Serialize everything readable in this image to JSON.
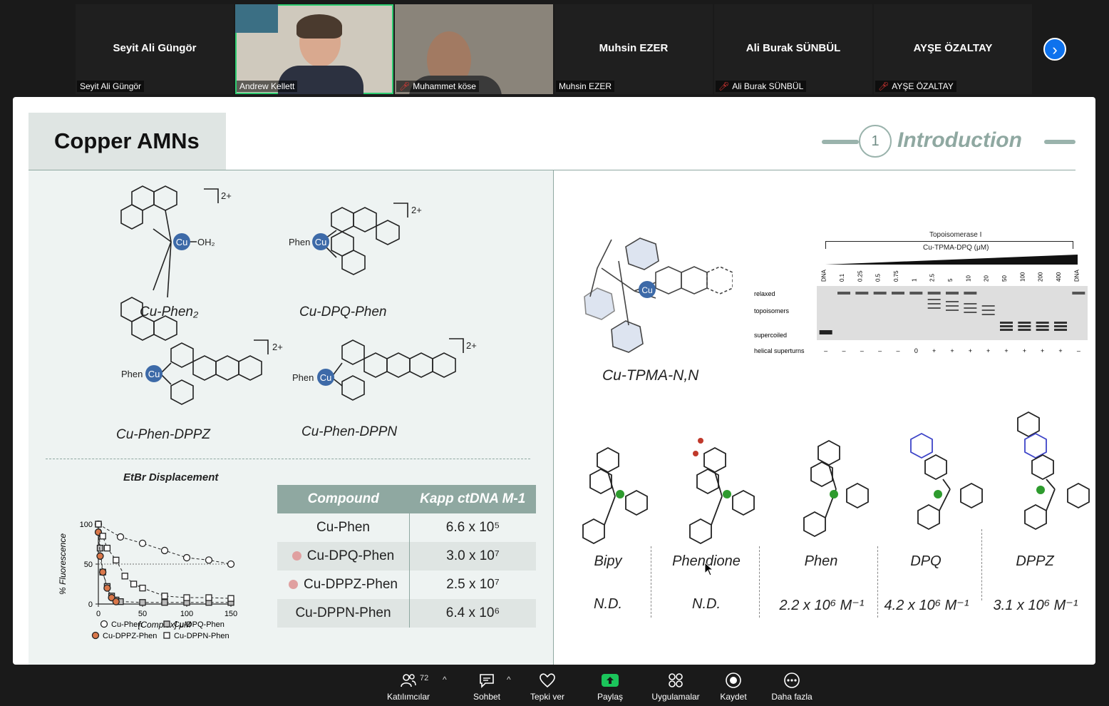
{
  "participants": [
    {
      "display": "Seyit Ali Güngör",
      "label": "Seyit Ali Güngör",
      "muted": false,
      "video": false
    },
    {
      "display": "",
      "label": "Andrew Kellett",
      "muted": false,
      "video": true,
      "speaking": true
    },
    {
      "display": "",
      "label": "Muhammet köse",
      "muted": true,
      "video": true
    },
    {
      "display": "Muhsin EZER",
      "label": "Muhsin EZER",
      "muted": false,
      "video": false
    },
    {
      "display": "Ali Burak SÜNBÜL",
      "label": "Ali Burak SÜNBÜL",
      "muted": true,
      "video": false
    },
    {
      "display": "AYŞE ÖZALTAY",
      "label": "AYŞE ÖZALTAY",
      "muted": true,
      "video": false
    }
  ],
  "slide": {
    "title": "Copper AMNs",
    "section_number": "1",
    "section_title": "Introduction",
    "molecules_top": [
      {
        "name": "Cu-Phen₂",
        "charge": "2+"
      },
      {
        "name": "Cu-DPQ-Phen",
        "charge": "2+"
      },
      {
        "name": "Cu-Phen-DPPZ",
        "charge": "2+"
      },
      {
        "name": "Cu-Phen-DPPN",
        "charge": "2+"
      }
    ],
    "atom_labels": {
      "cu": "Cu",
      "phen": "Phen",
      "oh2": "OH₂",
      "n": "N"
    },
    "right_molecule": "Cu-TPMA-N,N",
    "gel": {
      "title": "Topoisomerase I",
      "subtitle": "Cu-TPMA-DPQ (μM)",
      "lanes": [
        "DNA",
        "0.1",
        "0.25",
        "0.5",
        "0.75",
        "1",
        "2.5",
        "5",
        "10",
        "20",
        "50",
        "100",
        "200",
        "400",
        "DNA"
      ],
      "row_labels": [
        "relaxed",
        "topoisomers",
        "supercoiled",
        "helical superturns"
      ],
      "superturns": [
        "–",
        "–",
        "–",
        "–",
        "–",
        "0",
        "+",
        "+",
        "+",
        "+",
        "+",
        "+",
        "+",
        "+",
        "–"
      ]
    },
    "table": {
      "headers": [
        "Compound",
        "Kapp ctDNA M-1"
      ],
      "rows": [
        {
          "compound": "Cu-Phen",
          "value": "6.6 x 10⁵",
          "marker": false
        },
        {
          "compound": "Cu-DPQ-Phen",
          "value": "3.0 x 10⁷",
          "marker": true
        },
        {
          "compound": "Cu-DPPZ-Phen",
          "value": "2.5 x 10⁷",
          "marker": true
        },
        {
          "compound": "Cu-DPPN-Phen",
          "value": "6.4 x 10⁶",
          "marker": false
        }
      ]
    },
    "bottom_row": [
      {
        "name": "Bipy",
        "value": "N.D."
      },
      {
        "name": "Phendione",
        "value": "N.D."
      },
      {
        "name": "Phen",
        "value": "2.2 x 10⁶ M⁻¹"
      },
      {
        "name": "DPQ",
        "value": "4.2 x 10⁶ M⁻¹"
      },
      {
        "name": "DPPZ",
        "value": "3.1 x 10⁶ M⁻¹"
      }
    ]
  },
  "chart_data": {
    "type": "line",
    "title": "EtBr Displacement",
    "xlabel": "[Complex] μM",
    "ylabel": "% Fluorescence",
    "xlim": [
      0,
      150
    ],
    "ylim": [
      0,
      100
    ],
    "xticks": [
      0,
      50,
      100,
      150
    ],
    "yticks": [
      0,
      50,
      100
    ],
    "reference_line_y": 50,
    "series": [
      {
        "name": "Cu-Phen",
        "marker": "circle-open",
        "x": [
          0,
          25,
          50,
          75,
          100,
          125,
          150
        ],
        "y": [
          100,
          84,
          76,
          67,
          58,
          55,
          50
        ]
      },
      {
        "name": "Cu-DPQ-Phen",
        "marker": "square-gray",
        "x": [
          0,
          2,
          5,
          10,
          15,
          20,
          25,
          50,
          75,
          100,
          125,
          150
        ],
        "y": [
          100,
          70,
          40,
          22,
          10,
          5,
          3,
          2,
          2,
          2,
          2,
          2
        ]
      },
      {
        "name": "Cu-DPPZ-Phen",
        "marker": "circle-orange",
        "x": [
          0,
          2,
          5,
          10,
          15,
          20
        ],
        "y": [
          90,
          60,
          40,
          20,
          8,
          3
        ]
      },
      {
        "name": "Cu-DPPN-Phen",
        "marker": "square-open",
        "x": [
          0,
          5,
          10,
          20,
          30,
          40,
          50,
          75,
          100,
          125,
          150
        ],
        "y": [
          100,
          85,
          70,
          55,
          35,
          25,
          20,
          10,
          8,
          8,
          7
        ]
      }
    ]
  },
  "toolbar": {
    "participants_label": "Katılımcılar",
    "participants_count": "72",
    "chat_label": "Sohbet",
    "react_label": "Tepki ver",
    "share_label": "Paylaş",
    "apps_label": "Uygulamalar",
    "record_label": "Kaydet",
    "more_label": "Daha fazla"
  },
  "colors": {
    "accent_blue": "#0e72ed",
    "share_green": "#1bc55b",
    "slide_teal": "#8fa8a1",
    "cu_blue": "#3d6aa8"
  }
}
